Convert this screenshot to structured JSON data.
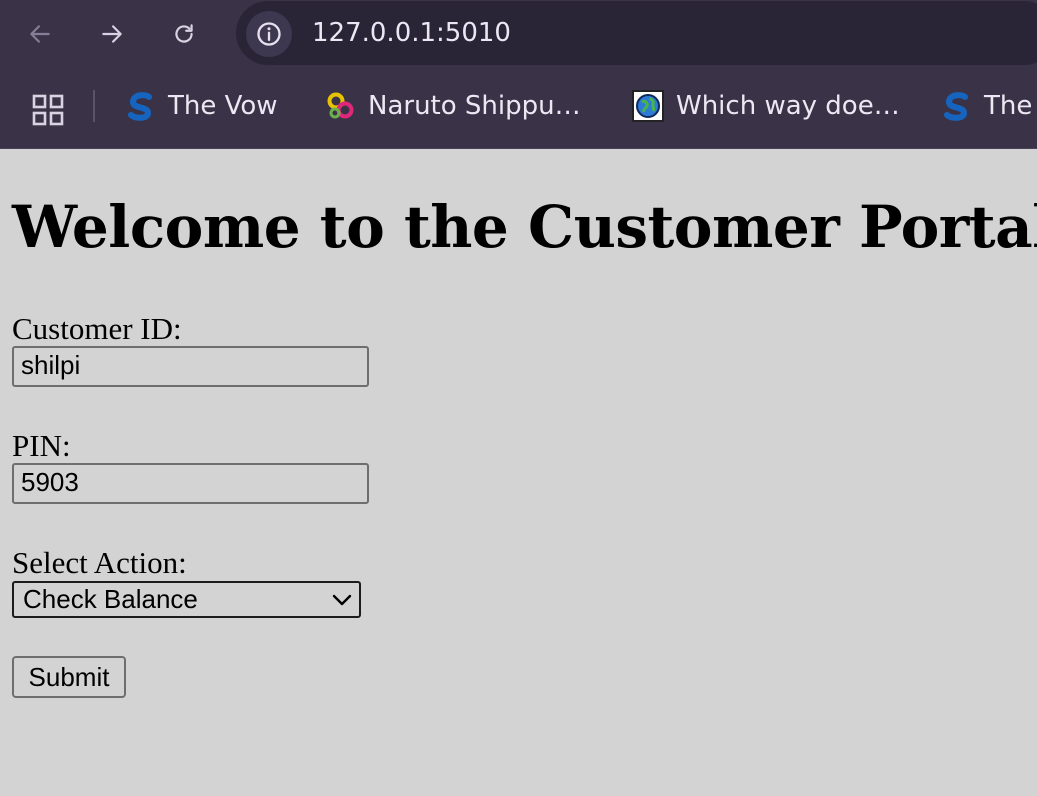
{
  "browser": {
    "url": "127.0.0.1:5010",
    "bookmarks": [
      {
        "label": "The Vow",
        "icon": "s-logo-icon"
      },
      {
        "label": "Naruto Shippu…",
        "icon": "chain-link-icon"
      },
      {
        "label": "Which way doe…",
        "icon": "globe-icon"
      },
      {
        "label": "The",
        "icon": "s-logo-icon"
      }
    ]
  },
  "page": {
    "title": "Welcome to the Customer Portal",
    "form": {
      "customer_id_label": "Customer ID:",
      "customer_id_value": "shilpi",
      "pin_label": "PIN:",
      "pin_value": "5903",
      "action_label": "Select Action:",
      "action_selected": "Check Balance",
      "submit_label": "Submit"
    }
  },
  "colors": {
    "page_background": "#d3d3d3",
    "browser_chrome": "#3a3348"
  }
}
